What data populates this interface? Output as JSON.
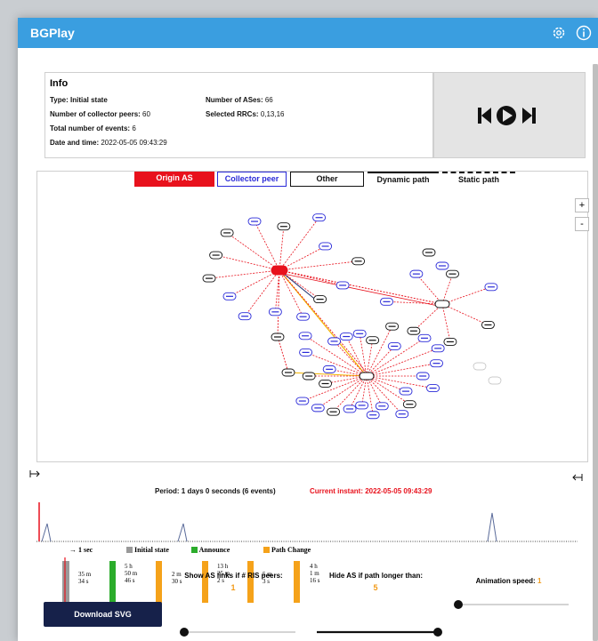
{
  "app": {
    "title": "BGPlay"
  },
  "titlebar": {
    "settings_icon": "gear-icon",
    "info_icon": "info-icon"
  },
  "info": {
    "header": "Info",
    "type_label": "Type:",
    "type_value": "Initial state",
    "collectors_label": "Number of collector peers:",
    "collectors_value": "60",
    "events_label": "Total number of events:",
    "events_value": "6",
    "date_label": "Date and time:",
    "date_value": "2022-05-05 09:43:29",
    "ases_label": "Number of ASes:",
    "ases_value": "66",
    "rrcs_label": "Selected RRCs:",
    "rrcs_value": "0,13,16"
  },
  "player": {
    "prev": "skip-back-icon",
    "play": "play-icon",
    "next": "skip-forward-icon"
  },
  "legend": {
    "origin": "Origin AS",
    "collector": "Collector peer",
    "other": "Other",
    "dynamic": "Dynamic path",
    "static": "Static path",
    "colors": {
      "origin": "#e8111c",
      "collector": "#2a2ad8",
      "edge": "#e8111c",
      "alt": "#f4b400",
      "dark": "#1a2a6a"
    }
  },
  "zoom": {
    "in": "+",
    "out": "-"
  },
  "timeline": {
    "period": "Period: 1 days 0 seconds (6 events)",
    "current": "Current instant: 2022-05-05 09:43:29",
    "legend": {
      "sec": "1 sec",
      "initial": "Initial state",
      "announce": "Announce",
      "path_change": "Path Change"
    },
    "durations": [
      [
        "35 m",
        "34 s"
      ],
      [
        "5 h",
        "50 m",
        "46 s"
      ],
      [
        "2 m",
        "30 s"
      ],
      [
        "13 h",
        "25 m",
        "2 s"
      ],
      [
        "5 m",
        "3 s"
      ],
      [
        "4 h",
        "1 m",
        "16 s"
      ]
    ]
  },
  "controls": {
    "download": "Download SVG",
    "show_links_label": "Show AS links if # RIS peers:",
    "show_links_value": "1",
    "hide_as_label": "Hide AS if path longer than:",
    "hide_as_value": "5",
    "speed_label": "Animation speed:",
    "speed_value": "1"
  }
}
